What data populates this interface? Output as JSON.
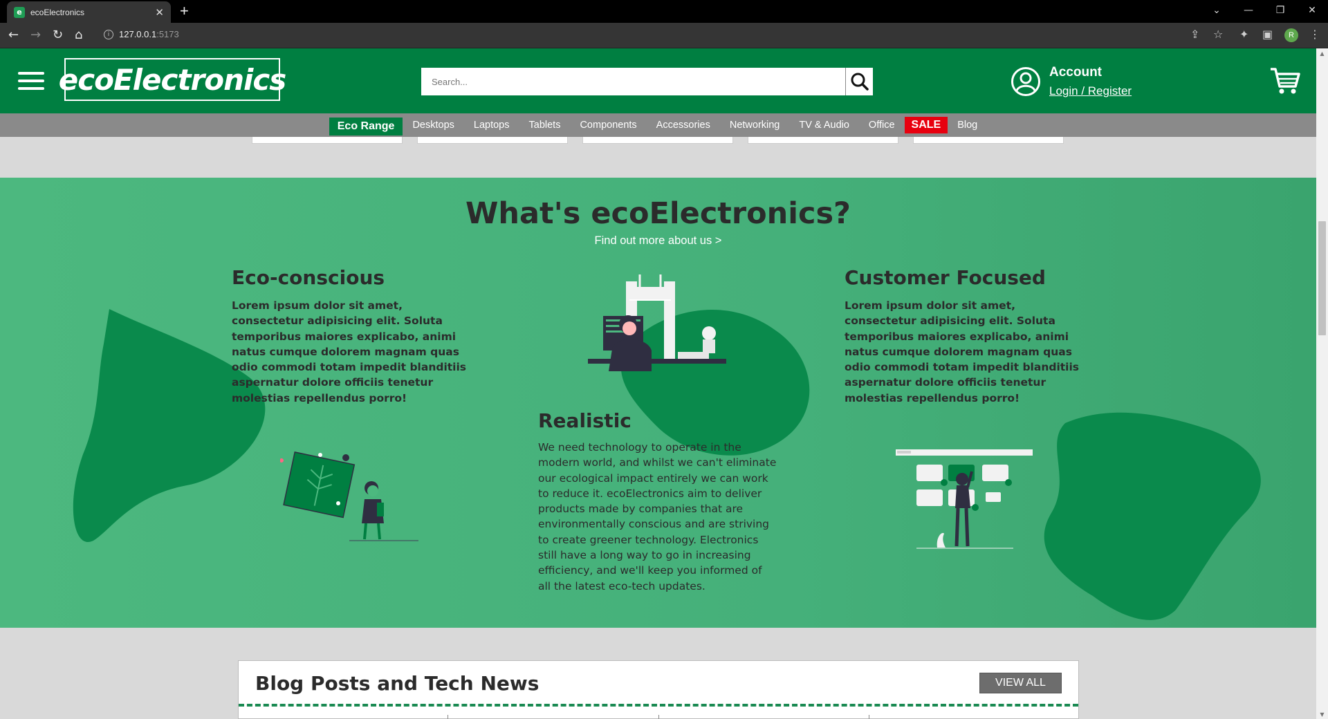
{
  "browser": {
    "tab_title": "ecoElectronics",
    "favicon_letter": "e",
    "url_host": "127.0.0.1",
    "url_port": ":5173",
    "profile_initial": "R"
  },
  "header": {
    "logo": "ecoElectronics",
    "search_placeholder": "Search...",
    "account_title": "Account",
    "account_link": "Login / Register"
  },
  "nav": {
    "items": [
      "Eco Range",
      "Desktops",
      "Laptops",
      "Tablets",
      "Components",
      "Accessories",
      "Networking",
      "TV & Audio",
      "Office",
      "SALE",
      "Blog"
    ]
  },
  "about": {
    "title": "What's ecoElectronics?",
    "link": "Find out more about us >",
    "eco": {
      "heading": "Eco-conscious",
      "text": "Lorem ipsum dolor sit amet, consectetur adipisicing elit. Soluta temporibus maiores explicabo, animi natus cumque dolorem magnam quas odio commodi totam impedit blanditiis aspernatur dolore officiis tenetur molestias repellendus porro!"
    },
    "realistic": {
      "heading": "Realistic",
      "text": "We need technology to operate in the modern world, and whilst we can't eliminate our ecological impact entirely we can work to reduce it. ecoElectronics aim to deliver products made by companies that are environmentally conscious and are striving to create greener technology. Electronics still have a long way to go in increasing efficiency, and we'll keep you informed of all the latest eco-tech updates."
    },
    "customer": {
      "heading": "Customer Focused",
      "text": "Lorem ipsum dolor sit amet, consectetur adipisicing elit. Soluta temporibus maiores explicabo, animi natus cumque dolorem magnam quas odio commodi totam impedit blanditiis aspernatur dolore officiis tenetur molestias repellendus porro!"
    }
  },
  "blog": {
    "title": "Blog Posts and Tech News",
    "view_all": "VIEW ALL"
  },
  "colors": {
    "brand_green": "#007f41",
    "section_green": "#45b07a",
    "blob_green": "#0a8a4c",
    "sale_red": "#e8000f",
    "nav_gray": "#8a8a8a"
  }
}
